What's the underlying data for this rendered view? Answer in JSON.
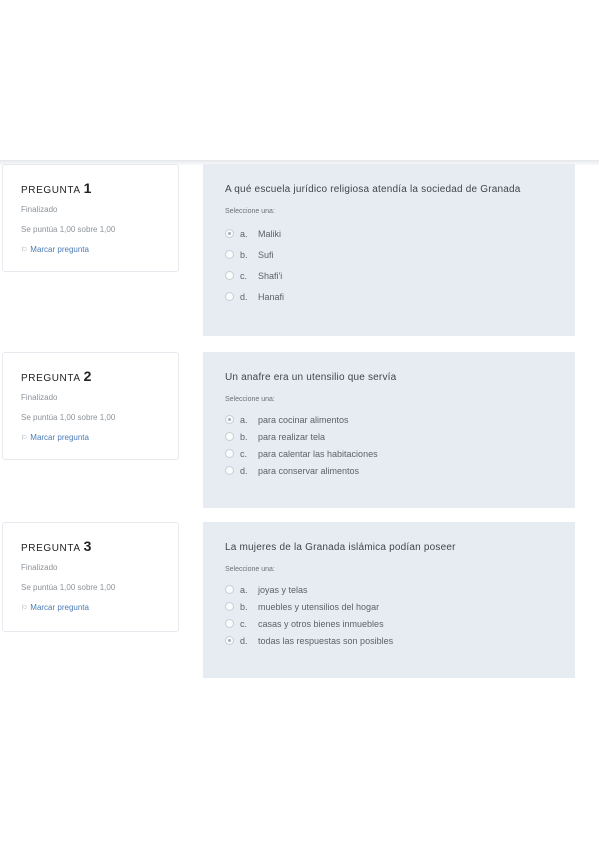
{
  "questions": [
    {
      "title_label": "PREGUNTA",
      "number": "1",
      "state": "Finalizado",
      "grade": "Se puntúa 1,00 sobre 1,00",
      "flag_label": "Marcar pregunta",
      "text": "A qué escuela jurídico religiosa atendía la sociedad de Granada",
      "prompt": "Seleccione una:",
      "answers": [
        {
          "letter": "a.",
          "text": "Maliki",
          "checked": true
        },
        {
          "letter": "b.",
          "text": "Sufi",
          "checked": false
        },
        {
          "letter": "c.",
          "text": "Shafi'i",
          "checked": false
        },
        {
          "letter": "d.",
          "text": "Hanafi",
          "checked": false
        }
      ]
    },
    {
      "title_label": "PREGUNTA",
      "number": "2",
      "state": "Finalizado",
      "grade": "Se puntúa 1,00 sobre 1,00",
      "flag_label": "Marcar pregunta",
      "text": "Un anafre era un utensilio que servía",
      "prompt": "Seleccione una:",
      "answers": [
        {
          "letter": "a.",
          "text": "para cocinar alimentos",
          "checked": true
        },
        {
          "letter": "b.",
          "text": "para realizar tela",
          "checked": false
        },
        {
          "letter": "c.",
          "text": "para calentar las habitaciones",
          "checked": false
        },
        {
          "letter": "d.",
          "text": "para conservar alimentos",
          "checked": false
        }
      ]
    },
    {
      "title_label": "PREGUNTA",
      "number": "3",
      "state": "Finalizado",
      "grade": "Se puntúa 1,00 sobre 1,00",
      "flag_label": "Marcar pregunta",
      "text": "La mujeres de la Granada islámica podían poseer",
      "prompt": "Seleccione una:",
      "answers": [
        {
          "letter": "a.",
          "text": "joyas y telas",
          "checked": false
        },
        {
          "letter": "b.",
          "text": "muebles y utensilios del hogar",
          "checked": false
        },
        {
          "letter": "c.",
          "text": "casas y otros bienes inmuebles",
          "checked": false
        },
        {
          "letter": "d.",
          "text": "todas las respuestas son posibles",
          "checked": true
        }
      ]
    }
  ],
  "icons": {
    "flag": "flag-icon"
  }
}
